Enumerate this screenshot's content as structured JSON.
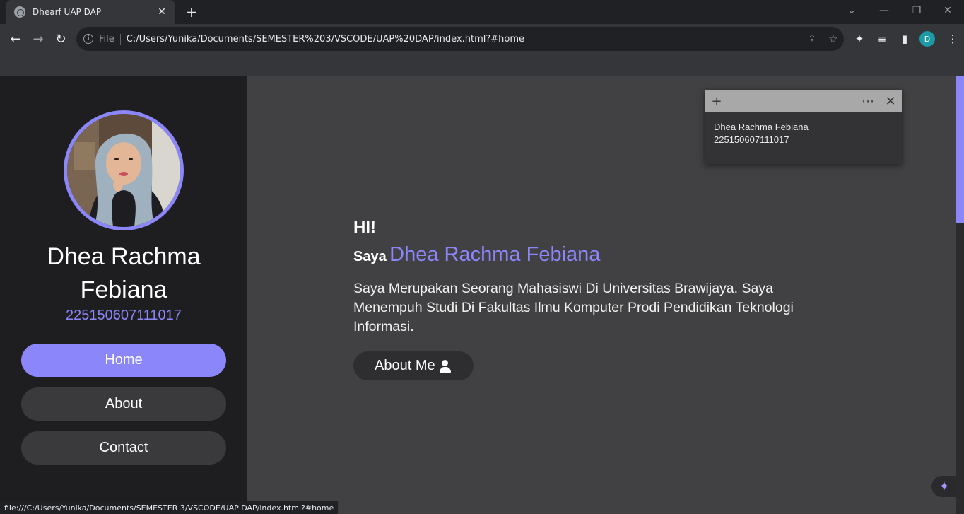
{
  "browser": {
    "tab_title": "Dhearf UAP DAP",
    "tab_close": "✕",
    "new_tab": "+",
    "scheme_label": "File",
    "url": "C:/Users/Yunika/Documents/SEMESTER%203/VSCODE/UAP%20DAP/index.html?#home",
    "profile_initial": "D",
    "status_url": "file:///C:/Users/Yunika/Documents/SEMESTER 3/VSCODE/UAP DAP/index.html?#home"
  },
  "sidebar": {
    "name": "Dhea Rachma Febiana",
    "nim": "225150607111017",
    "nav": [
      {
        "label": "Home",
        "active": true
      },
      {
        "label": "About",
        "active": false
      },
      {
        "label": "Contact",
        "active": false
      }
    ]
  },
  "main": {
    "greeting": "HI!",
    "intro_prefix": "Saya",
    "intro_name": "Dhea Rachma Febiana",
    "description": "Saya Merupakan Seorang Mahasiswi Di Universitas Brawijaya. Saya Menempuh Studi Di Fakultas Ilmu Komputer Prodi Pendidikan Teknologi Informasi.",
    "about_button": "About Me"
  },
  "sticky_note": {
    "line1": "Dhea Rachma Febiana",
    "line2": "225150607111017"
  },
  "colors": {
    "accent": "#8b86f9",
    "sidebar_bg": "#1e1e20",
    "content_bg": "#414042",
    "button_bg": "#3a393c"
  }
}
